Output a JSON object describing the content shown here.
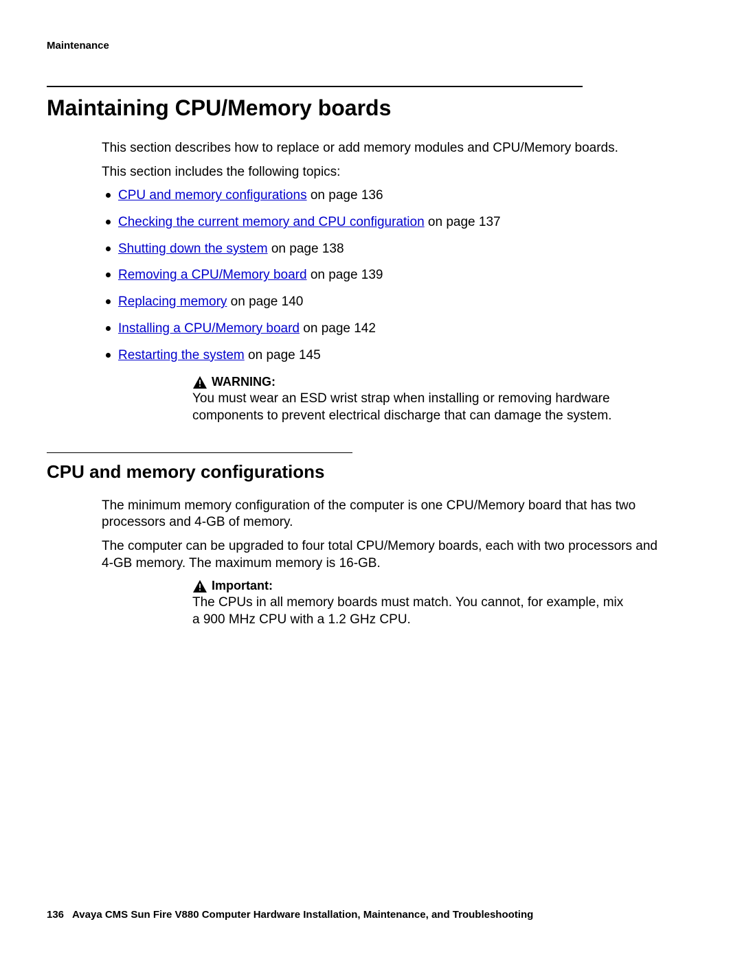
{
  "header": {
    "section": "Maintenance"
  },
  "main": {
    "title": "Maintaining CPU/Memory boards",
    "intro": "This section describes how to replace or add memory modules and CPU/Memory boards.",
    "topics_lead": "This section includes the following topics:",
    "topics": [
      {
        "link": "CPU and memory configurations",
        "suffix": " on page 136"
      },
      {
        "link": "Checking the current memory and CPU configuration",
        "suffix": " on page 137"
      },
      {
        "link": "Shutting down the system",
        "suffix": " on page 138"
      },
      {
        "link": "Removing a CPU/Memory board",
        "suffix": " on page 139"
      },
      {
        "link": "Replacing memory",
        "suffix": " on page 140"
      },
      {
        "link": "Installing a CPU/Memory board",
        "suffix": " on page 142"
      },
      {
        "link": "Restarting the system",
        "suffix": " on page 145"
      }
    ],
    "warning": {
      "label": "WARNING:",
      "text": "You must wear an ESD wrist strap when installing or removing hardware components to prevent electrical discharge that can damage the system."
    }
  },
  "subsection": {
    "title": "CPU and memory configurations",
    "p1": "The minimum memory configuration of the computer is one CPU/Memory board that has two processors and 4-GB of memory.",
    "p2": "The computer can be upgraded to four total CPU/Memory boards, each with two processors and 4-GB memory. The maximum memory is 16-GB.",
    "important": {
      "label": "Important:",
      "text": "The CPUs in all memory boards must match. You cannot, for example, mix a 900 MHz CPU with a 1.2 GHz CPU."
    }
  },
  "footer": {
    "page": "136",
    "title": "Avaya CMS Sun Fire V880 Computer Hardware Installation, Maintenance, and Troubleshooting"
  }
}
